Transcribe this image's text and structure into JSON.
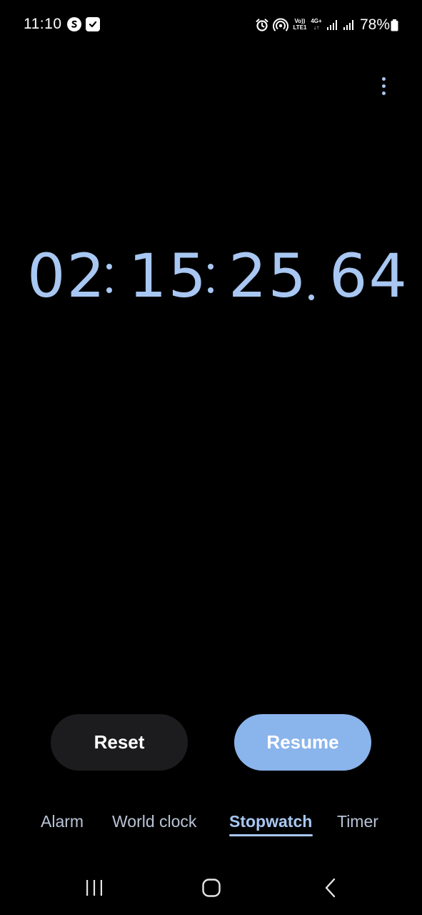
{
  "status_bar": {
    "time": "11:10",
    "left_icons": [
      "skype-icon",
      "checkbox-icon"
    ],
    "right_icons": [
      "alarm-icon",
      "hotspot-icon",
      "volte-lte-icon",
      "4g-data-icon",
      "signal-icon",
      "signal-icon"
    ],
    "volte_top": "Vo))",
    "volte_bottom": "LTE1",
    "data_top": "4G+",
    "data_bottom": "↓↑",
    "battery_percent": "78%"
  },
  "menu": {
    "more_icon": "more-vertical-icon"
  },
  "stopwatch": {
    "hours": "02",
    "minutes": "15",
    "seconds": "25",
    "hundredths": "64"
  },
  "buttons": {
    "reset_label": "Reset",
    "resume_label": "Resume"
  },
  "tabs": [
    {
      "label": "Alarm",
      "active": false
    },
    {
      "label": "World clock",
      "active": false
    },
    {
      "label": "Stopwatch",
      "active": true
    },
    {
      "label": "Timer",
      "active": false
    }
  ],
  "nav_bar": {
    "icons": [
      "recent-apps-icon",
      "home-icon",
      "back-icon"
    ]
  },
  "colors": {
    "background": "#000000",
    "accent": "#a8c7f2",
    "resume_button": "#8ab4ec",
    "reset_button": "#1c1c1e",
    "tab_inactive": "#b9c4d6"
  }
}
